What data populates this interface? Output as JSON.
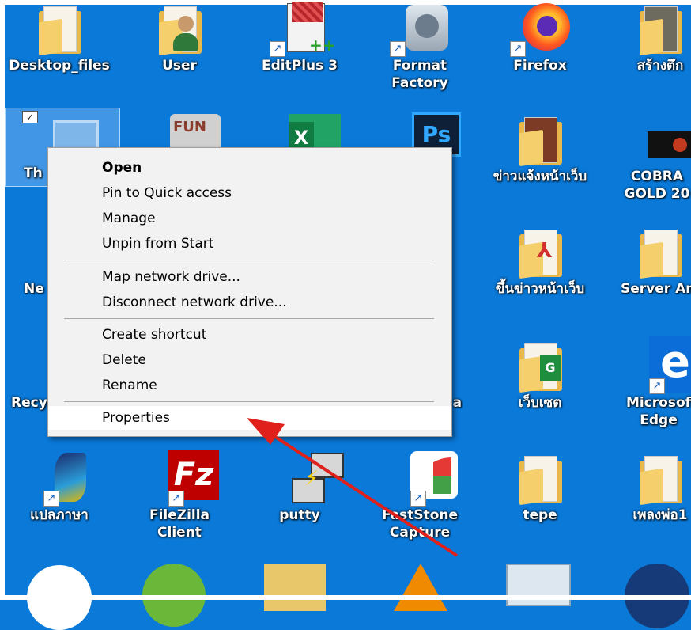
{
  "desktop": {
    "icons": [
      {
        "name": "desktop-files",
        "label": "Desktop_files"
      },
      {
        "name": "user",
        "label": "User"
      },
      {
        "name": "editplus",
        "label": "EditPlus 3"
      },
      {
        "name": "format-factory",
        "label": "Format\nFactory"
      },
      {
        "name": "firefox",
        "label": "Firefox"
      },
      {
        "name": "sang-tuek",
        "label": "สร้างตึก"
      },
      {
        "name": "this-pc",
        "label": "Th"
      },
      {
        "name": "fun",
        "label": "FUN"
      },
      {
        "name": "excel",
        "label": "X"
      },
      {
        "name": "photoshop",
        "label": "Ps"
      },
      {
        "name": "news-folder-1",
        "label": "ข่าวแจ้งหน้าเว็บ"
      },
      {
        "name": "cobra-gold",
        "label": "COBRA\nGOLD 20"
      },
      {
        "name": "network",
        "label": "Ne"
      },
      {
        "name": "news-folder-2",
        "label": "ขึ้นข่าวหน้าเว็บ"
      },
      {
        "name": "server",
        "label": "Server Am"
      },
      {
        "name": "recycle-bin",
        "label": "Recy"
      },
      {
        "name": "web-set",
        "label": "เว็บเซต"
      },
      {
        "name": "edge",
        "label": "Microsof\nEdge"
      },
      {
        "name": "translate",
        "label": "แปลภาษา"
      },
      {
        "name": "filezilla",
        "label": "FileZilla\nClient"
      },
      {
        "name": "putty",
        "label": "putty"
      },
      {
        "name": "faststone",
        "label": "FastStone\nCapture"
      },
      {
        "name": "tepe",
        "label": "tepe"
      },
      {
        "name": "songs",
        "label": "เพลงพ่อ1"
      },
      {
        "name": "partial-a",
        "label": "a"
      }
    ]
  },
  "context_menu": {
    "items": [
      "Open",
      "Pin to Quick access",
      "Manage",
      "Unpin from Start",
      "Map network drive...",
      "Disconnect network drive...",
      "Create shortcut",
      "Delete",
      "Rename",
      "Properties"
    ]
  },
  "colors": {
    "desktop_bg": "#0a79d8",
    "menu_bg": "#f2f2f2",
    "arrow": "#e0201a"
  }
}
